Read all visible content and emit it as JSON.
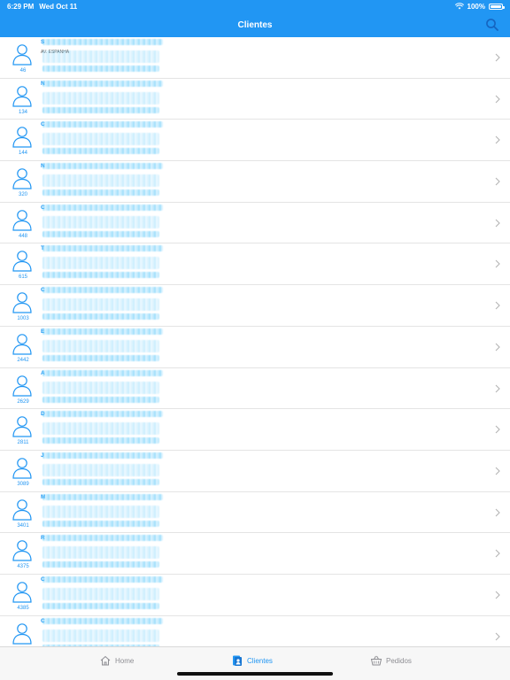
{
  "status_bar": {
    "time": "6:29 PM",
    "date": "Wed Oct 11",
    "battery": "100%"
  },
  "nav": {
    "title": "Clientes"
  },
  "clients": [
    {
      "code": "46",
      "name": "S",
      "address": "AV. ESPANHA",
      "phone": ""
    },
    {
      "code": "134",
      "name": "N",
      "address": "",
      "phone": ""
    },
    {
      "code": "144",
      "name": "C",
      "address": "",
      "phone": ""
    },
    {
      "code": "320",
      "name": "N",
      "address": "",
      "phone": ""
    },
    {
      "code": "448",
      "name": "C",
      "address": "",
      "phone": ""
    },
    {
      "code": "615",
      "name": "T",
      "address": "",
      "phone": ""
    },
    {
      "code": "1003",
      "name": "C",
      "address": "",
      "phone": ""
    },
    {
      "code": "2442",
      "name": "E",
      "address": "",
      "phone": ""
    },
    {
      "code": "2629",
      "name": "A",
      "address": "",
      "phone": ""
    },
    {
      "code": "2811",
      "name": "D",
      "address": "",
      "phone": ""
    },
    {
      "code": "3089",
      "name": "J",
      "address": "",
      "phone": ""
    },
    {
      "code": "3401",
      "name": "M",
      "address": "",
      "phone": ""
    },
    {
      "code": "4375",
      "name": "R",
      "address": "",
      "phone": ""
    },
    {
      "code": "4385",
      "name": "C",
      "address": "",
      "phone": ""
    },
    {
      "code": "",
      "name": "C",
      "address": "",
      "phone": ""
    }
  ],
  "tabs": {
    "home": "Home",
    "clientes": "Clientes",
    "pedidos": "Pedidos"
  },
  "colors": {
    "accent": "#2196f3",
    "inactive": "#8e8e93"
  },
  "icons": {
    "avatar": "person-outline-icon",
    "chevron": "chevron-right-icon",
    "search": "search-icon"
  }
}
